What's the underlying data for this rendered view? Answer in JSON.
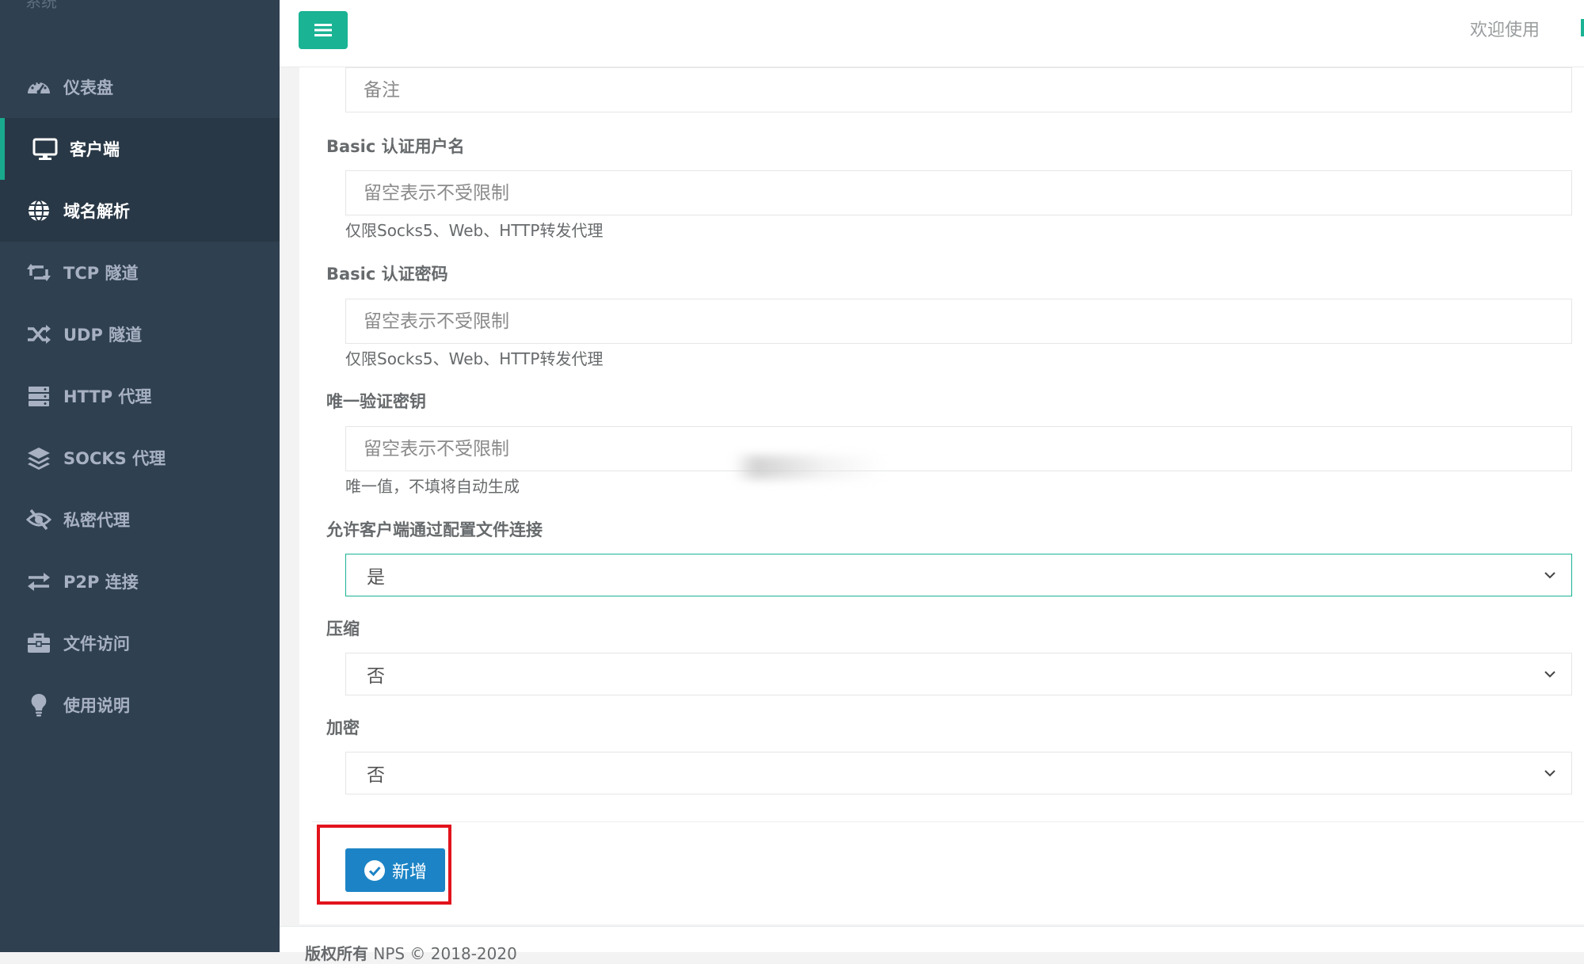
{
  "sidebar": {
    "brand": "系统",
    "items": [
      {
        "label": "仪表盘",
        "icon": "dashboard-icon"
      },
      {
        "label": "客户端",
        "icon": "desktop-icon"
      },
      {
        "label": "域名解析",
        "icon": "globe-icon"
      },
      {
        "label": "TCP 隧道",
        "icon": "retweet-icon"
      },
      {
        "label": "UDP 隧道",
        "icon": "random-icon"
      },
      {
        "label": "HTTP 代理",
        "icon": "server-icon"
      },
      {
        "label": "SOCKS 代理",
        "icon": "layers-icon"
      },
      {
        "label": "私密代理",
        "icon": "eye-slash-icon"
      },
      {
        "label": "P2P 连接",
        "icon": "exchange-icon"
      },
      {
        "label": "文件访问",
        "icon": "briefcase-icon"
      },
      {
        "label": "使用说明",
        "icon": "lightbulb-icon"
      }
    ]
  },
  "header": {
    "welcome": "欢迎使用"
  },
  "form": {
    "remark": {
      "placeholder": "备注",
      "value": ""
    },
    "basic_user": {
      "label": "Basic 认证用户名",
      "placeholder": "留空表示不受限制",
      "help": "仅限Socks5、Web、HTTP转发代理"
    },
    "basic_pass": {
      "label": "Basic 认证密码",
      "placeholder": "留空表示不受限制",
      "help": "仅限Socks5、Web、HTTP转发代理"
    },
    "vkey": {
      "label": "唯一验证密钥",
      "placeholder": "留空表示不受限制",
      "help": "唯一值，不填将自动生成"
    },
    "config_conn": {
      "label": "允许客户端通过配置文件连接",
      "value": "是"
    },
    "compress": {
      "label": "压缩",
      "value": "否"
    },
    "crypt": {
      "label": "加密",
      "value": "否"
    },
    "submit_label": "新增"
  },
  "footer": {
    "copyright_bold": "版权所有",
    "copyright_text": " NPS © 2018-2020"
  },
  "colors": {
    "sidebar_bg": "#2f4050",
    "accent": "#1ab394",
    "primary_button": "#1c84c6",
    "highlight": "#e2131c"
  }
}
